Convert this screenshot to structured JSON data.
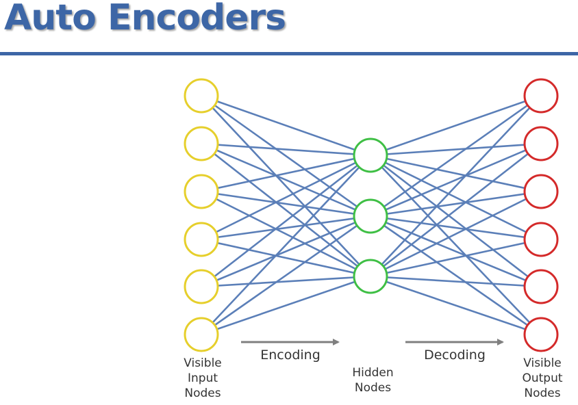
{
  "title": "Auto Encoders",
  "colors": {
    "accent": "#3d66a6",
    "edge": "#5b7fb8",
    "input_node": "#e6cf2c",
    "hidden_node": "#3fbf45",
    "output_node": "#d42a2a",
    "arrow": "#7f7f7f"
  },
  "diagram": {
    "input_nodes": 6,
    "hidden_nodes": 3,
    "output_nodes": 6,
    "labels": {
      "input": [
        "Visible",
        "Input",
        "Nodes"
      ],
      "hidden": [
        "Hidden",
        "Nodes"
      ],
      "output": [
        "Visible",
        "Output",
        "Nodes"
      ],
      "encoding": "Encoding",
      "decoding": "Decoding"
    }
  }
}
